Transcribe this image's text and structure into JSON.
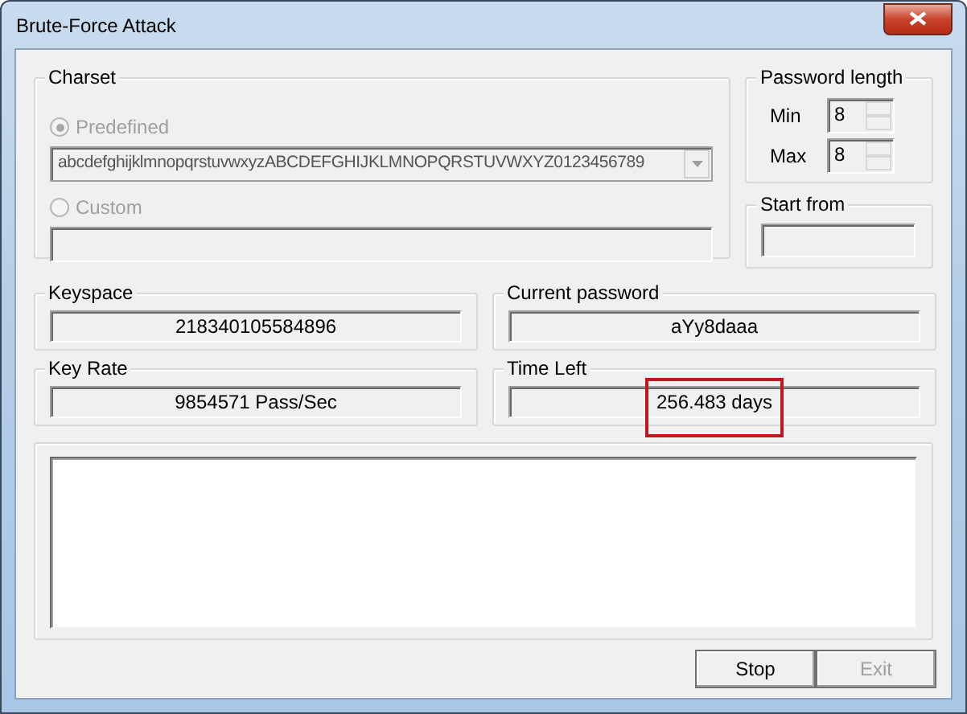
{
  "window": {
    "title": "Brute-Force Attack"
  },
  "charset": {
    "label": "Charset",
    "options": [
      {
        "label": "Predefined",
        "selected": true,
        "disabled": true,
        "kind": "dropdown",
        "value": "abcdefghijklmnopqrstuvwxyzABCDEFGHIJKLMNOPQRSTUVWXYZ0123456789"
      },
      {
        "label": "Custom",
        "selected": false,
        "disabled": true,
        "kind": "text"
      }
    ]
  },
  "password_length": {
    "label": "Password length",
    "fields": [
      {
        "label": "Min",
        "value": "8"
      },
      {
        "label": "Max",
        "value": "8"
      }
    ]
  },
  "start_from": {
    "label": "Start from"
  },
  "stats": [
    {
      "label": "Keyspace",
      "value": "218340105584896",
      "highlighted": false
    },
    {
      "label": "Current password",
      "value": "aYy8daaa",
      "highlighted": false
    },
    {
      "label": "Key Rate",
      "value": "9854571 Pass/Sec",
      "highlighted": false
    },
    {
      "label": "Time Left",
      "value": "256.483 days",
      "highlighted": true
    }
  ],
  "buttons": [
    {
      "label": "Stop",
      "disabled": false
    },
    {
      "label": "Exit",
      "disabled": true
    }
  ]
}
